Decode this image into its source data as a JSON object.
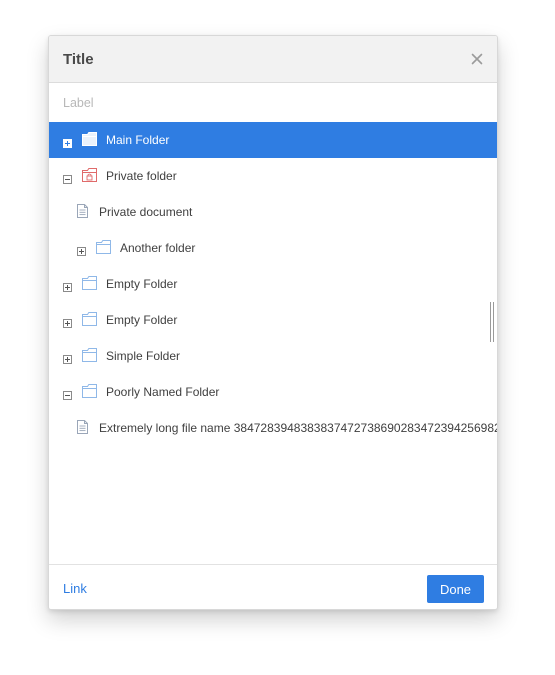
{
  "dialog": {
    "title": "Title",
    "label": "Label"
  },
  "tree": {
    "items": [
      {
        "label": "Main Folder",
        "type": "folder",
        "state": "collapsed",
        "level": 0,
        "selected": true
      },
      {
        "label": "Private folder",
        "type": "folder-locked",
        "state": "expanded",
        "level": 0,
        "selected": false
      },
      {
        "label": "Private document",
        "type": "file",
        "state": "leaf",
        "level": 1,
        "selected": false
      },
      {
        "label": "Another folder",
        "type": "folder",
        "state": "collapsed",
        "level": 1,
        "selected": false
      },
      {
        "label": "Empty Folder",
        "type": "folder",
        "state": "collapsed",
        "level": 0,
        "selected": false
      },
      {
        "label": "Empty Folder",
        "type": "folder",
        "state": "collapsed",
        "level": 0,
        "selected": false
      },
      {
        "label": "Simple Folder",
        "type": "folder",
        "state": "collapsed",
        "level": 0,
        "selected": false
      },
      {
        "label": "Poorly Named Folder",
        "type": "folder",
        "state": "expanded",
        "level": 0,
        "selected": false
      },
      {
        "label": "Extremely long file name 3847283948383837472738690283472394256982",
        "type": "file",
        "state": "leaf",
        "level": 1,
        "selected": false
      }
    ]
  },
  "footer": {
    "link_label": "Link",
    "done_label": "Done"
  },
  "colors": {
    "accent": "#2f7de2",
    "folder": "#8fb8e8",
    "locked_folder": "#e06a6a",
    "file": "#9aa6b8"
  }
}
